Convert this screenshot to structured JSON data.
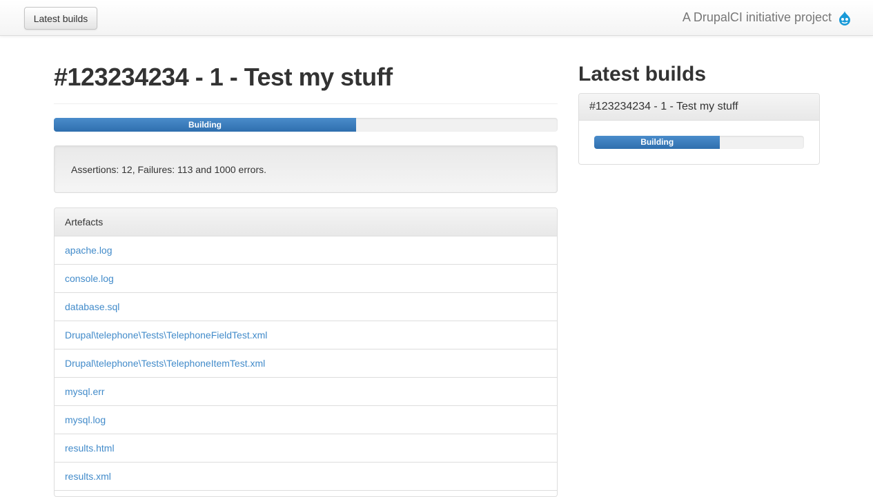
{
  "navbar": {
    "latest_builds_button": "Latest builds",
    "brand": "A DrupalCI initiative project",
    "brand_icon": "drupal-drop-icon",
    "brand_icon_color": "#1a9ad8"
  },
  "build": {
    "title": "#123234234 - 1 - Test my stuff",
    "progress_label": "Building",
    "progress_percent": 60,
    "progress_color": "#2f6fae",
    "summary": "Assertions: 12, Failures: 113 and 1000 errors."
  },
  "artefacts": {
    "heading": "Artefacts",
    "link_color": "#428bca",
    "items": [
      "apache.log",
      "console.log",
      "database.sql",
      "Drupal\\telephone\\Tests\\TelephoneFieldTest.xml",
      "Drupal\\telephone\\Tests\\TelephoneItemTest.xml",
      "mysql.err",
      "mysql.log",
      "results.html",
      "results.xml"
    ]
  },
  "sidebar": {
    "title": "Latest builds",
    "builds": [
      {
        "title": "#123234234 - 1 - Test my stuff",
        "progress_label": "Building",
        "progress_percent": 60
      }
    ]
  }
}
